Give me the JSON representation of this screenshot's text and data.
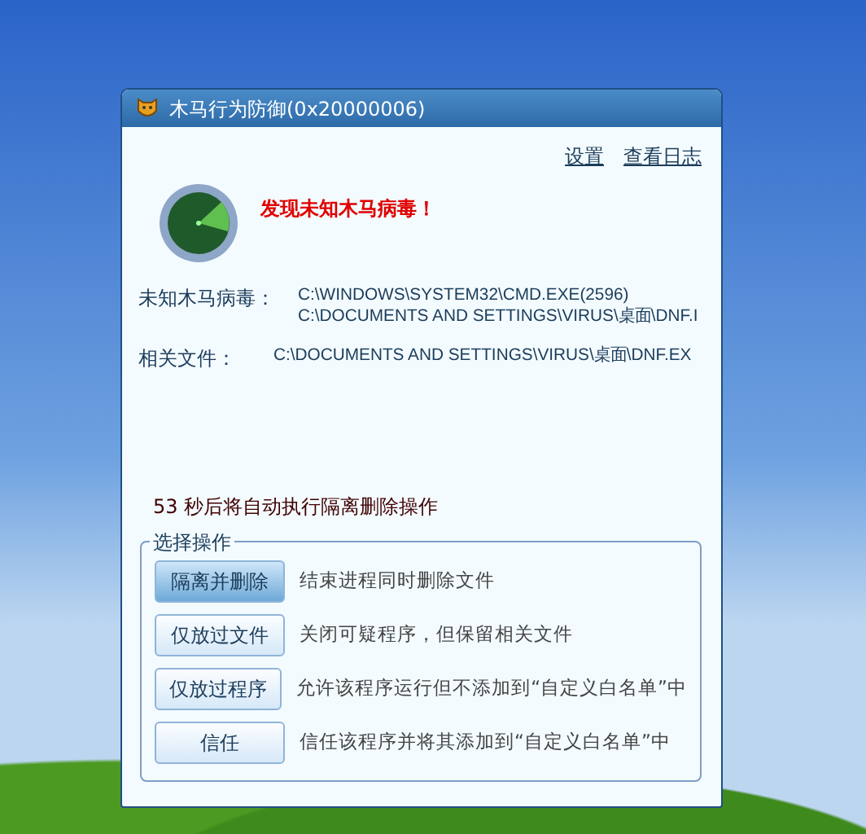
{
  "window": {
    "title": "木马行为防御(0x20000006)"
  },
  "links": [
    "设置",
    "查看日志"
  ],
  "alert": "发现未知木马病毒！",
  "details": [
    {
      "label": "未知木马病毒：",
      "values": [
        "C:\\WINDOWS\\SYSTEM32\\CMD.EXE(2596)",
        "C:\\DOCUMENTS AND SETTINGS\\VIRUS\\桌面\\DNF.I"
      ]
    },
    {
      "label": "相关文件：",
      "values": [
        "C:\\DOCUMENTS AND SETTINGS\\VIRUS\\桌面\\DNF.EX"
      ]
    }
  ],
  "countdown": "53 秒后将自动执行隔离删除操作",
  "action_group": {
    "legend": "选择操作",
    "actions": [
      {
        "label": "隔离并删除",
        "description": "结束进程同时删除文件",
        "selected": true
      },
      {
        "label": "仅放过文件",
        "description": "关闭可疑程序，但保留相关文件",
        "selected": false
      },
      {
        "label": "仅放过程序",
        "description": "允许该程序运行但不添加到“自定义白名单”中",
        "selected": false
      },
      {
        "label": "信任",
        "description": "信任该程序并将其添加到“自定义白名单”中",
        "selected": false
      }
    ]
  }
}
